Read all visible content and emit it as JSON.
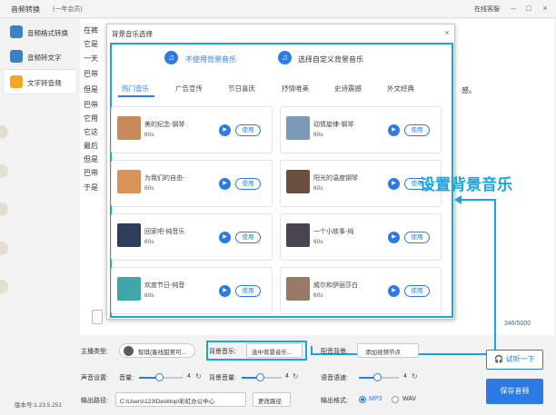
{
  "app": {
    "title": "音频转换",
    "badge": "(一年会员)",
    "online_help": "在线客服",
    "version": "版本号:1.23.5.251"
  },
  "window_controls": {
    "minimize": "–",
    "maximize": "□",
    "close": "×"
  },
  "sidebar": {
    "items": [
      {
        "label": "音频格式转换",
        "icon": "format-convert-icon",
        "color": "#3b82c4"
      },
      {
        "label": "音频转文字",
        "icon": "audio-to-text-icon",
        "color": "#3b82c4"
      },
      {
        "label": "文字转音频",
        "icon": "text-to-audio-icon",
        "color": "#f5a623"
      }
    ]
  },
  "editor": {
    "lines": [
      "在裤",
      "它是",
      "一天",
      "巴带",
      "但是",
      "巴带",
      "它用",
      "它这",
      "最后",
      "但是",
      "巴带",
      "于是"
    ],
    "line_tail": "感。",
    "char_count": "346/5000"
  },
  "dialog": {
    "title": "背景音乐选择",
    "close": "×",
    "option_none": "不使用背景音乐",
    "option_custom": "选择自定义背景音乐",
    "tabs": [
      "热门音乐",
      "广告宣传",
      "节日喜庆",
      "抒情唯美",
      "史诗震撼",
      "外文经典"
    ],
    "use_label": "使用",
    "play_glyph": "▶",
    "music": [
      {
        "name": "美的纪念-钢琴",
        "duration": "60s",
        "color": "#c98a5a"
      },
      {
        "name": "动情旋律-钢琴",
        "duration": "60s",
        "color": "#7a9ab8"
      },
      {
        "name": "为我们的自由-",
        "duration": "60s",
        "color": "#d8925a"
      },
      {
        "name": "阳光的温度钢琴",
        "duration": "60s",
        "color": "#6b5040"
      },
      {
        "name": "回家吧-纯音乐",
        "duration": "60s",
        "color": "#2e3d5a"
      },
      {
        "name": "一个小故事-纯",
        "duration": "60s",
        "color": "#4a4452"
      },
      {
        "name": "欢度节日-纯音",
        "duration": "60s",
        "color": "#3fa7a8"
      },
      {
        "name": "威尔和伊丽莎白",
        "duration": "60s",
        "color": "#9a7a66"
      }
    ]
  },
  "settings": {
    "host_type_label": "主播类型:",
    "host_value": "智琪(客线甜美可...",
    "bgm_label": "背景音乐:",
    "bgm_button": "选中背景音乐...",
    "dub_label": "配音背景:",
    "dub_button": "添加视频节点",
    "volume_label": "声音设置:",
    "volume_sub": "音量:",
    "volume_value": "4",
    "bg_volume_label": "背景音量:",
    "bg_volume_value": "4",
    "speed_label": "语音语速:",
    "speed_value": "4",
    "output_path_label": "输出路径:",
    "output_path_value": "C:\\Users\\123\\Desktop\\彩虹办公中心",
    "change_path_button": "更改路径",
    "output_format_label": "输出格式:",
    "format_mp3": "MP3",
    "format_wav": "WAV",
    "preview_button": "试听一下",
    "save_button": "保存音频"
  },
  "annotation": {
    "text": "设置背景音乐",
    "color": "#1ba4e0"
  },
  "colors": {
    "accent": "#2c7be5",
    "highlight": "#1ba4e0"
  }
}
